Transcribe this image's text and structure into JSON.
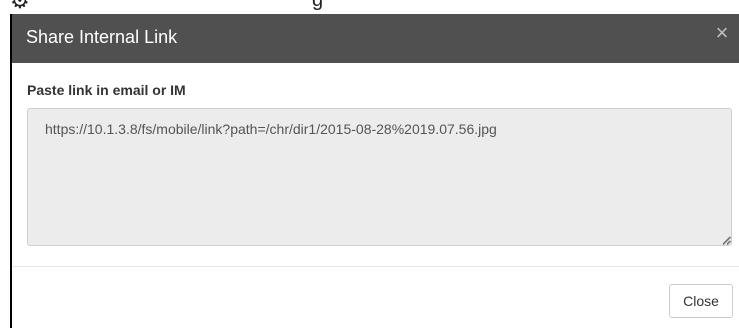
{
  "background": {
    "gear_glyph": "⚙",
    "partial_text": "g"
  },
  "dialog": {
    "title": "Share Internal Link",
    "close_glyph": "×",
    "field_label": "Paste link in email or IM",
    "link_value": "https://10.1.3.8/fs/mobile/link?path=/chr/dir1/2015-08-28%2019.07.56.jpg",
    "close_button_label": "Close"
  },
  "colors": {
    "header_bg": "#505050",
    "header_text": "#ffffff",
    "textarea_bg": "#ececec"
  }
}
